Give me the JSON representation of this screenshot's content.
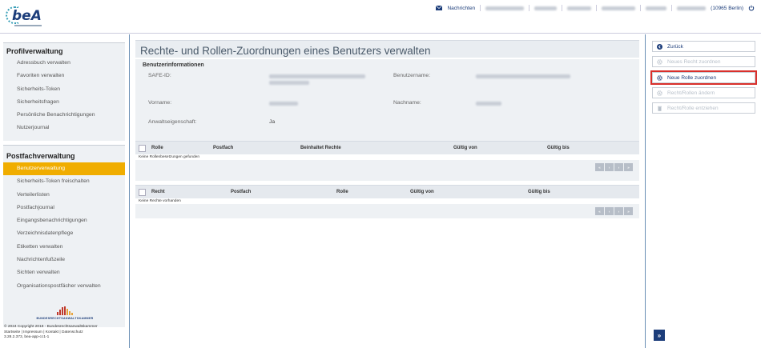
{
  "header": {
    "logo_text": "beA",
    "messages_label": "Nachrichten",
    "location_text": "(10965 Berlin)"
  },
  "sidebar": {
    "profil_title": "Profilverwaltung",
    "profil_items": [
      "Adressbuch verwalten",
      "Favoriten verwalten",
      "Sicherheits-Token",
      "Sicherheitsfragen",
      "Persönliche Benachrichtigungen",
      "Nutzerjournal"
    ],
    "postfach_title": "Postfachverwaltung",
    "postfach_items": [
      "Benutzerverwaltung",
      "Sicherheits-Token freischalten",
      "Verteilerlisten",
      "Postfachjournal",
      "Eingangsbenachrichtigungen",
      "Verzeichnisdatenpflege",
      "Etiketten verwalten",
      "Nachrichtenfußzeile",
      "Sichten verwalten",
      "Organisationspostfächer verwalten"
    ],
    "active_item": "Benutzerverwaltung",
    "bak_name": "BUNDESRECHTSANWALTSKAMMER",
    "footer_line1": "© 2024 Copyright 2018 - Bundesrechtsanwaltskammer",
    "footer_line2": "Startseite | Impressum | Kontakt | Datenschutz",
    "footer_line3": "3.28.2.373, bea-app-cc1-1"
  },
  "main": {
    "page_title": "Rechte- und Rollen-Zuordnungen eines Benutzers verwalten",
    "info_title": "Benutzerinformationen",
    "safe_id_label": "SAFE-ID:",
    "username_label": "Benutzername:",
    "firstname_label": "Vorname:",
    "lastname_label": "Nachname:",
    "lawyer_label": "Anwaltseigenschaft:",
    "lawyer_value": "Ja",
    "roles_table": {
      "columns": [
        "Rolle",
        "Postfach",
        "Beinhaltet Rechte",
        "Gültig von",
        "Gültig bis"
      ],
      "empty_message": "Keine Rollenbesetzungen gefunden"
    },
    "rights_table": {
      "columns": [
        "Recht",
        "Postfach",
        "Rolle",
        "Gültig von",
        "Gültig bis"
      ],
      "empty_message": "Keine Rechte vorhanden"
    },
    "pager": [
      "«",
      "‹",
      "›",
      "»"
    ]
  },
  "actions": {
    "back": "Zurück",
    "assign_right": "Neues Recht zuordnen",
    "assign_role": "Neue Rolle zuordnen",
    "change_right": "Recht/Rollen ändern",
    "revoke": "Recht/Rolle entziehen",
    "expand": "»"
  },
  "colors": {
    "brand_blue": "#1c3d7a",
    "active_orange": "#f0ad00",
    "highlight_red": "#d9302c"
  }
}
